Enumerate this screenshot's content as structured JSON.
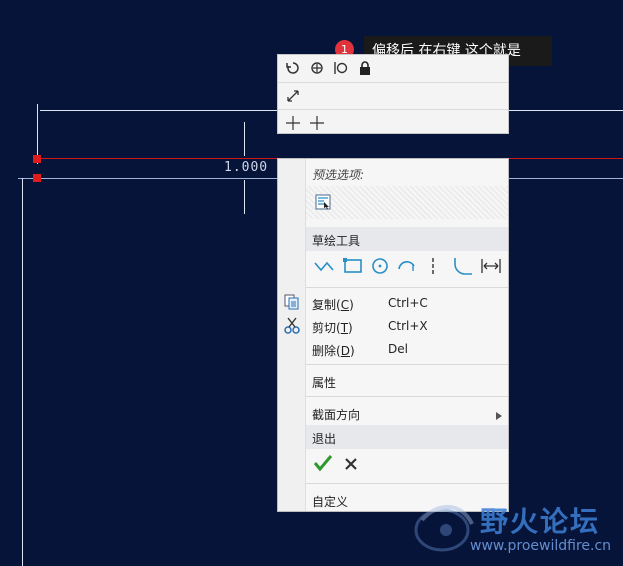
{
  "dimension": {
    "value": "1.000"
  },
  "tooltip": {
    "badge": "1",
    "text": "偏移后 在右键 这个就是"
  },
  "mini_toolbar": {
    "row1": [
      "undo-redo-icon",
      "constraint-icon",
      "sketch-view-icon",
      "lock-icon"
    ],
    "row2": [
      "dimension-arrow-icon"
    ],
    "row3": [
      "plus-icon",
      "plus-icon"
    ]
  },
  "menu": {
    "preselect_label": "预选选项:",
    "sketch_tools_header": "草绘工具",
    "copy": {
      "label": "复制(",
      "key": "C",
      "end": ")",
      "shortcut": "Ctrl+C"
    },
    "cut": {
      "label": "剪切(",
      "key": "T",
      "end": ")",
      "shortcut": "Ctrl+X"
    },
    "delete": {
      "label": "删除(",
      "key": "D",
      "end": ")",
      "shortcut": "Del"
    },
    "properties": "属性",
    "section_orient": "截面方向",
    "exit_header": "退出",
    "customize": "自定义",
    "colors": {
      "check": "#2e9a2e",
      "accent": "#2a8fc7"
    }
  },
  "watermark": {
    "title": "野火论坛",
    "url": "www.proewildfire.cn"
  }
}
